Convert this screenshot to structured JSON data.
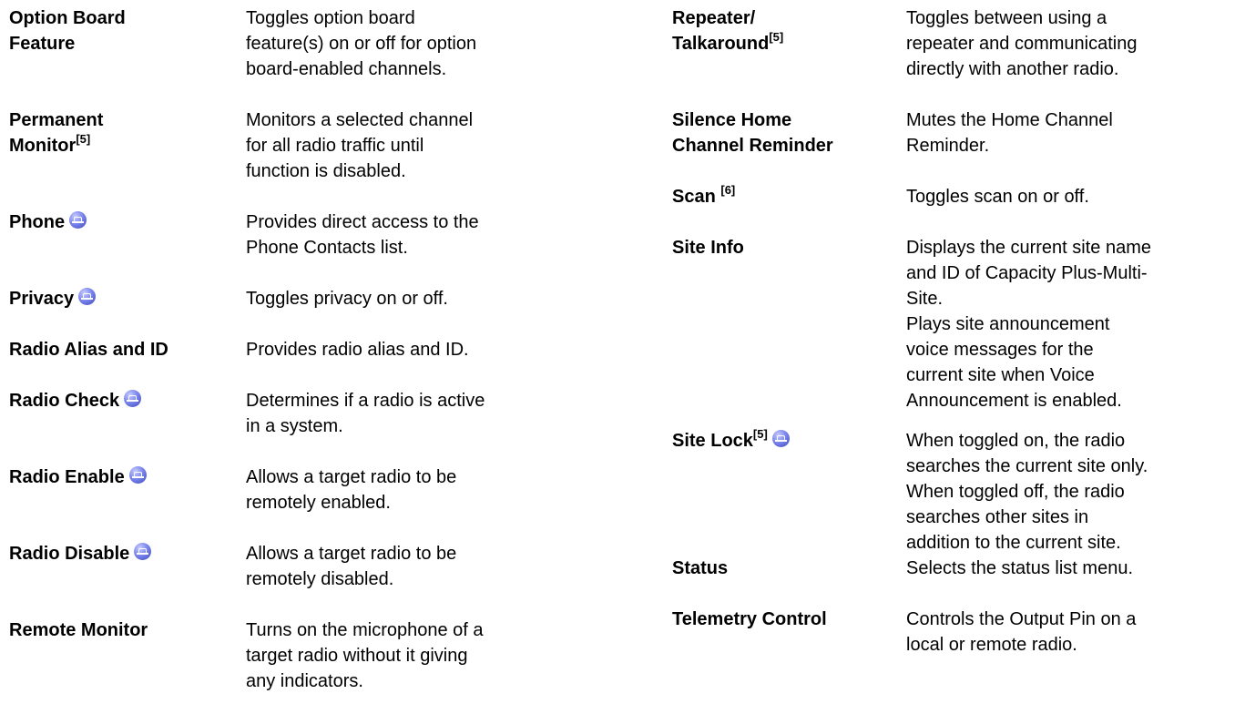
{
  "left_entries": [
    {
      "term": "Option Board",
      "term2": "Feature",
      "desc": [
        "Toggles option board",
        "feature(s) on or off for option",
        "board-enabled channels."
      ]
    },
    {
      "term": "Permanent",
      "term2": "Monitor",
      "sup": "[5]",
      "desc": [
        "Monitors a selected channel",
        "for all radio traffic until",
        "function is disabled."
      ]
    },
    {
      "term": "Phone",
      "icon": "capacity-plus-icon",
      "desc": [
        "Provides direct access to the",
        "Phone Contacts list."
      ]
    },
    {
      "term": "Privacy",
      "icon": "capacity-plus-icon",
      "desc": [
        "Toggles privacy on or off."
      ]
    },
    {
      "term": "Radio Alias and ID",
      "desc": [
        "Provides radio alias and ID."
      ]
    },
    {
      "term": "Radio Check",
      "icon": "capacity-plus-icon",
      "desc": [
        "Determines if a radio is active",
        "in a system."
      ]
    },
    {
      "term": "Radio Enable",
      "icon": "capacity-plus-icon",
      "desc": [
        "Allows a target radio to be",
        "remotely enabled."
      ]
    },
    {
      "term": "Radio Disable",
      "icon": "capacity-plus-icon",
      "desc": [
        "Allows a target radio to be",
        "remotely disabled."
      ]
    },
    {
      "term": "Remote Monitor",
      "desc": [
        "Turns on the microphone of a",
        "target radio without it giving",
        "any indicators."
      ]
    }
  ],
  "right_entries": [
    {
      "term": "Repeater/",
      "term2": "Talkaround",
      "sup": "[5]",
      "desc": [
        "Toggles between using a",
        "repeater and communicating",
        "directly with another radio."
      ]
    },
    {
      "term": "Silence Home",
      "term2": "Channel Reminder",
      "desc": [
        "Mutes the Home Channel",
        "Reminder."
      ]
    },
    {
      "term": "Scan ",
      "sup": "[6]",
      "desc": [
        "Toggles scan on or off."
      ]
    },
    {
      "term": "Site Info",
      "desc": [
        "Displays the current site name",
        "and ID of Capacity Plus-Multi-",
        "Site."
      ]
    },
    {
      "term": "",
      "desc": [
        "Plays site announcement",
        "voice messages for the",
        "current site when Voice",
        "Announcement is enabled."
      ]
    },
    {
      "term": "Site Lock",
      "sup": "[5]",
      "icon": "capacity-plus-icon",
      "desc": [
        "When toggled on, the radio",
        "searches the current site only.",
        "When toggled off, the radio",
        "searches other sites in",
        "addition to the current site."
      ]
    },
    {
      "term": "Status",
      "desc": [
        "Selects the status list menu."
      ]
    },
    {
      "term": "Telemetry Control",
      "desc": [
        "Controls the Output Pin on a",
        "local or remote radio."
      ]
    }
  ]
}
